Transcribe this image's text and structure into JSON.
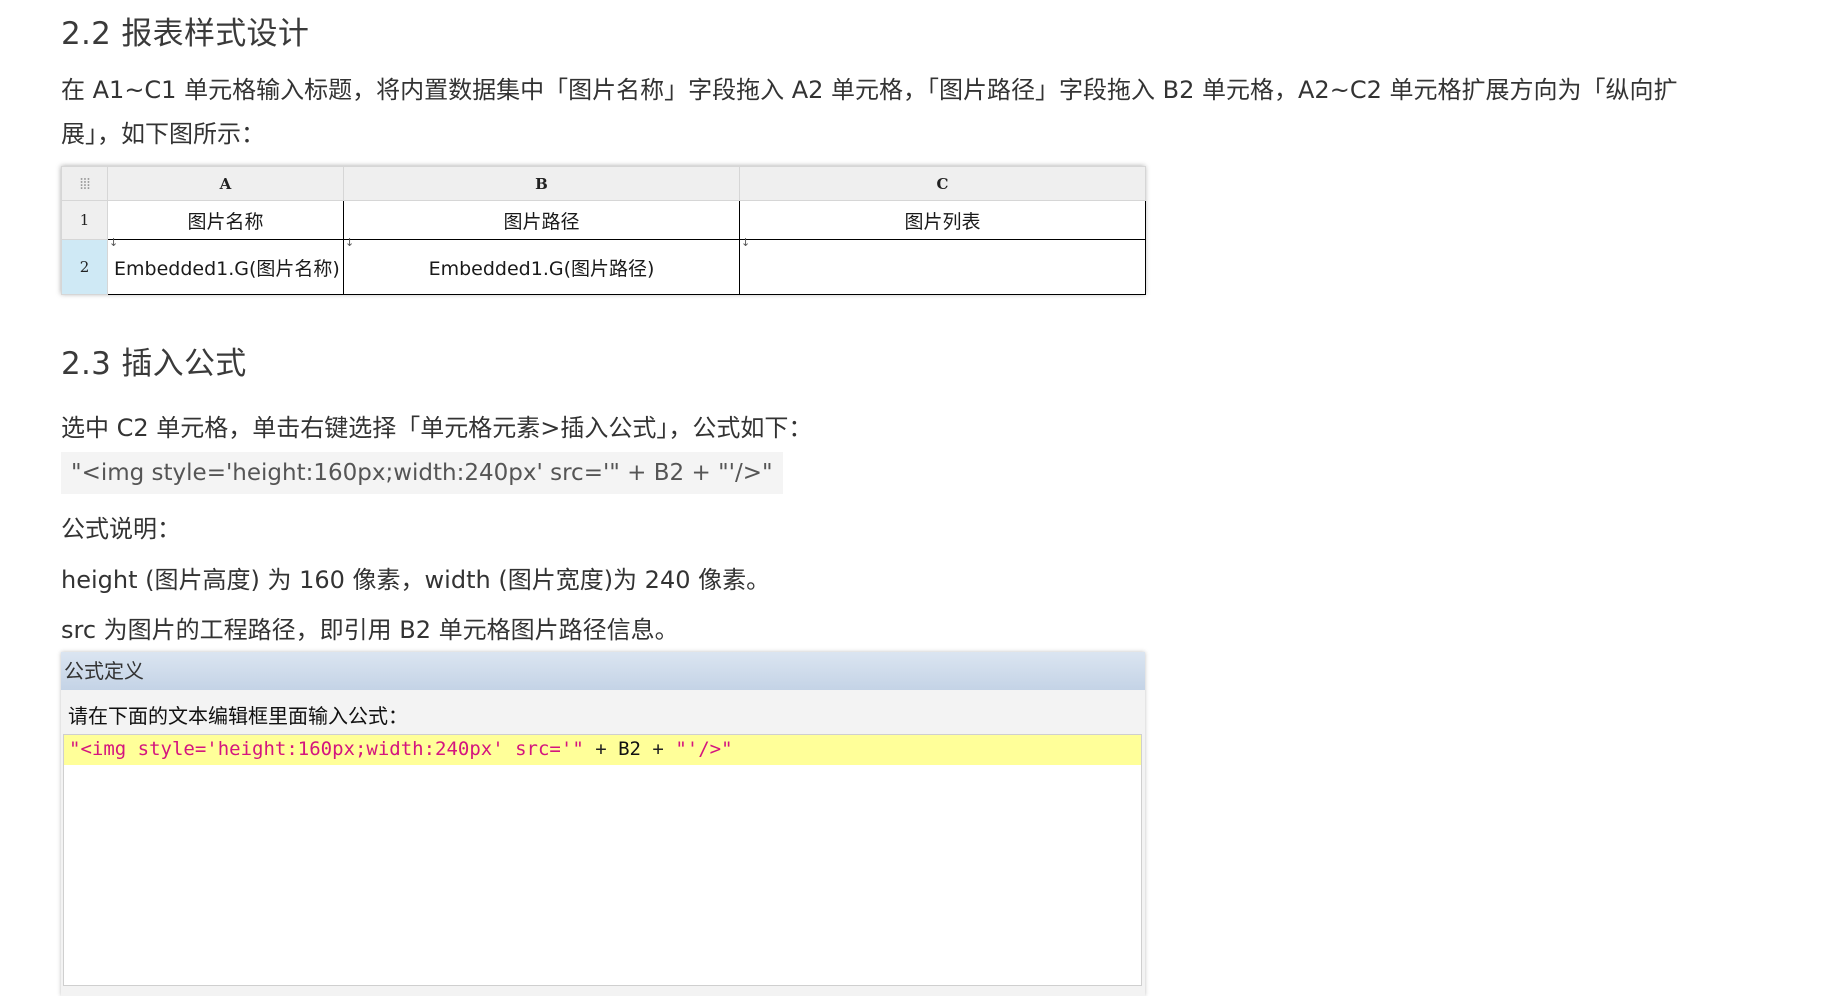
{
  "section_22": {
    "title": "2.2 报表样式设计",
    "intro_line1": "在 A1~C1 单元格输入标题，将内置数据集中「图片名称」字段拖入 A2 单元格，「图片路径」字段拖入 B2 单元格，A2~C2 单元格扩展方向为「纵向扩",
    "intro_line2": "展」，如下图所示："
  },
  "sheet": {
    "corner_icon": "grid-dots-icon",
    "columns": [
      "A",
      "B",
      "C"
    ],
    "rows": [
      {
        "num": "1",
        "cells": [
          "图片名称",
          "图片路径",
          "图片列表"
        ]
      },
      {
        "num": "2",
        "cells": [
          "Embedded1.G(图片名称)",
          "Embedded1.G(图片路径)",
          ""
        ]
      }
    ],
    "expand_marker": "↓",
    "selected_row_color": "#cfe9f5"
  },
  "section_23": {
    "title": "2.3 插入公式",
    "step": "选中 C2 单元格，单击右键选择「单元格元素>插入公式」，公式如下：",
    "formula": "\"<img style='height:160px;width:240px' src='\" + B2 + \"'/>\"",
    "explain_title": "公式说明：",
    "explain_height_width": "height (图片高度) 为 160 像素，width (图片宽度)为 240 像素。",
    "explain_src": "src 为图片的工程路径，即引用 B2 单元格图片路径信息。"
  },
  "dialog": {
    "title": "公式定义",
    "prompt": "请在下面的文本编辑框里面输入公式：",
    "code": {
      "str1": "\"<img style='height:160px;width:240px' src='\"",
      "op1": " + ",
      "ref": "B2",
      "op2": " + ",
      "str2": "\"'/>\""
    },
    "highlight_color": "#ffff99",
    "string_color": "#d4157e"
  }
}
